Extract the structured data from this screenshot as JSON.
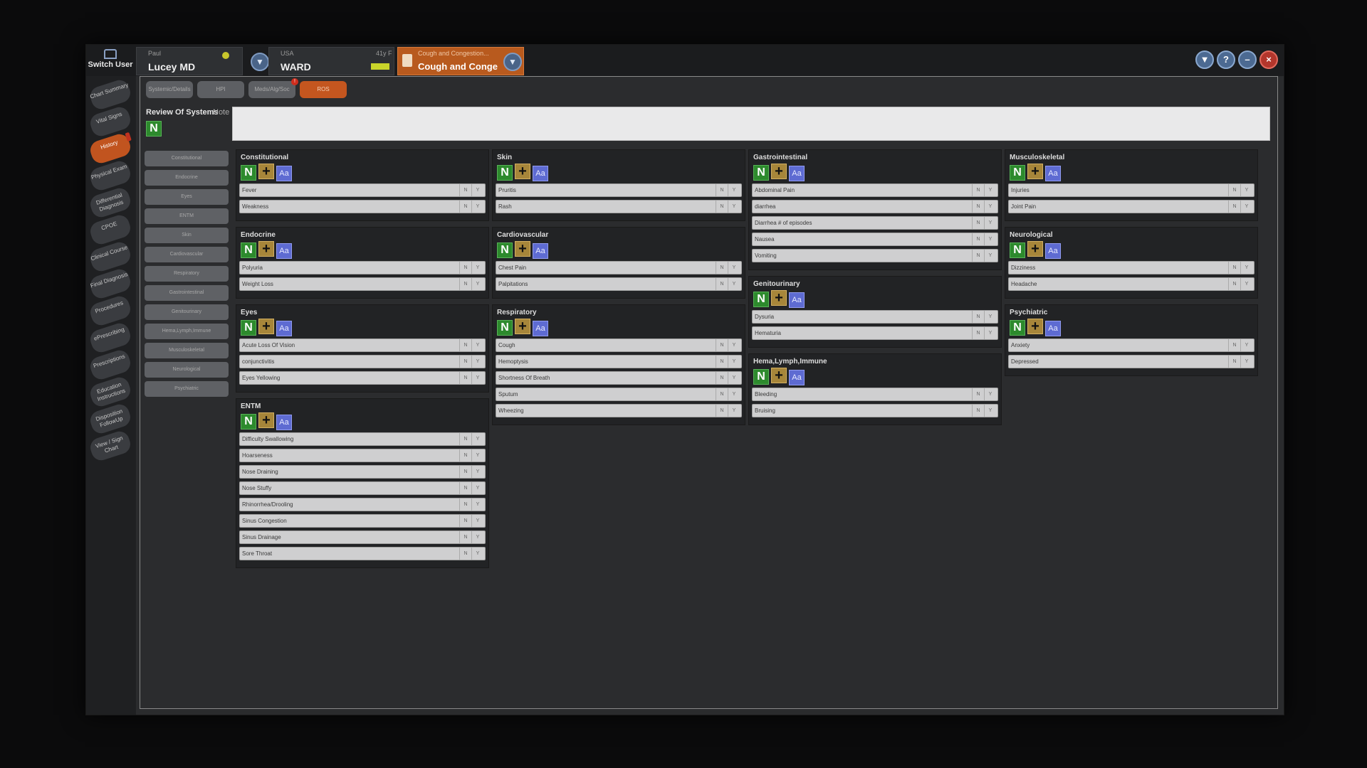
{
  "header": {
    "switch_user": "Switch User",
    "user_small": "Paul",
    "user_name": "Lucey MD",
    "location_small": "USA",
    "location_tag": "41y F",
    "location": "WARD",
    "case_small": "Cough and Congestion...",
    "case_title": "Cough and Conge"
  },
  "window_buttons": [
    "filter-icon",
    "help-icon",
    "minimize-icon",
    "close-icon"
  ],
  "leftnav": [
    {
      "label": "Chart Summary"
    },
    {
      "label": "Vital Signs"
    },
    {
      "label": "History"
    },
    {
      "label": "Physical Exam"
    },
    {
      "label": "Differential Diagnosis"
    },
    {
      "label": "CPOE"
    },
    {
      "label": "Clinical Course"
    },
    {
      "label": "Final Diagnosis"
    },
    {
      "label": "Procedures"
    },
    {
      "label": "ePrescribing"
    },
    {
      "label": "Prescriptions"
    },
    {
      "label": "Education Instructions"
    },
    {
      "label": "Disposition FollowUp"
    },
    {
      "label": "View / Sign Chart"
    }
  ],
  "tabs": [
    "Systemic/Details",
    "HPI",
    "Meds/Alg/Soc",
    "ROS"
  ],
  "ros": {
    "title": "Review Of Systems",
    "note_label": "Note",
    "n": "N"
  },
  "buttons": {
    "n": "N",
    "plus": "+",
    "aa": "Aa"
  },
  "systems_list": [
    "Constitutional",
    "Endocrine",
    "Eyes",
    "ENTM",
    "Skin",
    "Cardiovascular",
    "Respiratory",
    "Gastrointestinal",
    "Genitourinary",
    "Hema,Lymph,Immune",
    "Musculoskeletal",
    "Neurological",
    "Psychiatric"
  ],
  "panels": {
    "constitutional": {
      "title": "Constitutional",
      "items": [
        "Fever",
        "Weakness"
      ]
    },
    "endocrine": {
      "title": "Endocrine",
      "items": [
        "Polyuria",
        "Weight Loss"
      ]
    },
    "eyes": {
      "title": "Eyes",
      "items": [
        "Acute Loss Of Vision",
        "conjunctivitis",
        "Eyes Yellowing"
      ]
    },
    "entm": {
      "title": "ENTM",
      "items": [
        "Difficulty Swallowing",
        "Hoarseness",
        "Nose Draining",
        "Nose Stuffy",
        "Rhinorrhea/Drooling",
        "Sinus Congestion",
        "Sinus Drainage",
        "Sore Throat"
      ]
    },
    "skin": {
      "title": "Skin",
      "items": [
        "Pruritis",
        "Rash"
      ]
    },
    "cardiovascular": {
      "title": "Cardiovascular",
      "items": [
        "Chest Pain",
        "Palpitations"
      ]
    },
    "respiratory": {
      "title": "Respiratory",
      "items": [
        "Cough",
        "Hemoptysis",
        "Shortness Of Breath",
        "Sputum",
        "Wheezing"
      ]
    },
    "gastrointestinal": {
      "title": "Gastrointestinal",
      "items": [
        "Abdominal Pain",
        "diarrhea",
        "Diarrhea # of episodes",
        "Nausea",
        "Vomiting"
      ]
    },
    "genitourinary": {
      "title": "Genitourinary",
      "items": [
        "Dysuria",
        "Hematuria"
      ]
    },
    "hema": {
      "title": "Hema,Lymph,Immune",
      "items": [
        "Bleeding",
        "Bruising"
      ]
    },
    "musculoskeletal": {
      "title": "Musculoskeletal",
      "items": [
        "Injuries",
        "Joint Pain"
      ]
    },
    "neurological": {
      "title": "Neurological",
      "items": [
        "Dizziness",
        "Headache"
      ]
    },
    "psychiatric": {
      "title": "Psychiatric",
      "items": [
        "Anxiety",
        "Depressed"
      ]
    }
  },
  "item_toggles": [
    "N",
    "Y"
  ]
}
